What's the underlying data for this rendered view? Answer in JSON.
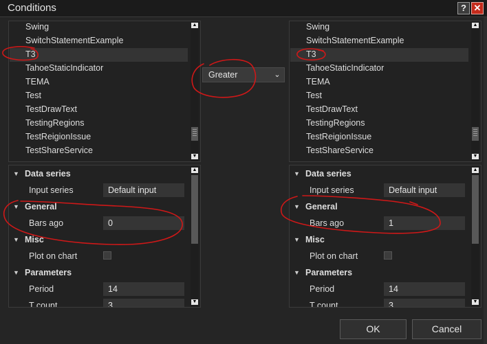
{
  "window": {
    "title": "Conditions",
    "help_label": "?",
    "close_label": "✕"
  },
  "left": {
    "list_items": [
      "Swing",
      "SwitchStatementExample",
      "T3",
      "TahoeStaticIndicator",
      "TEMA",
      "Test",
      "TestDrawText",
      "TestingRegions",
      "TestReigionIssue",
      "TestShareService"
    ],
    "selected_index": 2,
    "properties": {
      "data_series": "Data series",
      "input_series_label": "Input series",
      "input_series_value": "Default input",
      "general": "General",
      "bars_ago_label": "Bars ago",
      "bars_ago_value": "0",
      "misc": "Misc",
      "plot_on_chart_label": "Plot on chart",
      "plot_on_chart_checked": false,
      "parameters": "Parameters",
      "period_label": "Period",
      "period_value": "14",
      "tcount_label": "T count",
      "tcount_value": "3"
    }
  },
  "operator": {
    "selected": "Greater"
  },
  "right": {
    "list_items": [
      "Swing",
      "SwitchStatementExample",
      "T3",
      "TahoeStaticIndicator",
      "TEMA",
      "Test",
      "TestDrawText",
      "TestingRegions",
      "TestReigionIssue",
      "TestShareService"
    ],
    "selected_index": 2,
    "properties": {
      "data_series": "Data series",
      "input_series_label": "Input series",
      "input_series_value": "Default input",
      "general": "General",
      "bars_ago_label": "Bars ago",
      "bars_ago_value": "1",
      "misc": "Misc",
      "plot_on_chart_label": "Plot on chart",
      "plot_on_chart_checked": false,
      "parameters": "Parameters",
      "period_label": "Period",
      "period_value": "14",
      "tcount_label": "T count",
      "tcount_value": "3"
    }
  },
  "buttons": {
    "ok": "OK",
    "cancel": "Cancel"
  },
  "colors": {
    "annotation": "#d01818",
    "background": "#252525",
    "close_button": "#c42b1c"
  },
  "icons": {
    "collapse": "triangle-down-icon",
    "scroll_up": "arrow-up-icon",
    "scroll_down": "arrow-down-icon",
    "dropdown": "chevron-down-icon"
  }
}
